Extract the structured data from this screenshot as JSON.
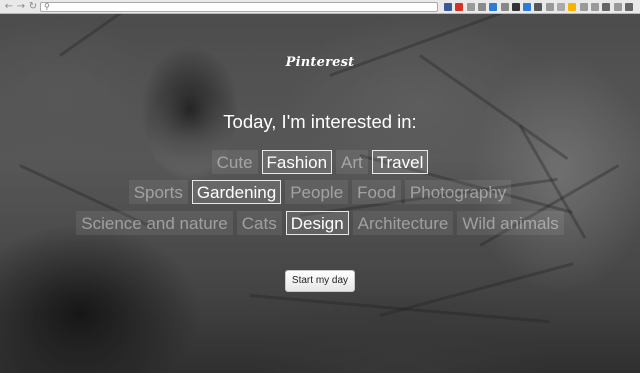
{
  "browser": {
    "back_glyph": "←",
    "forward_glyph": "→",
    "reload_glyph": "↻",
    "search_glyph": "⚲",
    "extension_icons": [
      {
        "name": "bookmark-icon",
        "color": "#3b5998"
      },
      {
        "name": "gmail-icon",
        "color": "#d93025"
      },
      {
        "name": "calendar-icon",
        "color": "#9a9a9a"
      },
      {
        "name": "thumb-icon",
        "color": "#8a8a8a"
      },
      {
        "name": "clock-icon",
        "color": "#2e7bd6"
      },
      {
        "name": "grid-icon",
        "color": "#888888"
      },
      {
        "name": "flash-icon",
        "color": "#333333"
      },
      {
        "name": "help-icon",
        "color": "#2e7bd6"
      },
      {
        "name": "circle-icon",
        "color": "#555555"
      },
      {
        "name": "photo-icon",
        "color": "#999999"
      },
      {
        "name": "box-icon",
        "color": "#aaaaaa"
      },
      {
        "name": "star-icon",
        "color": "#f4b400"
      },
      {
        "name": "window-icon",
        "color": "#9a9a9a"
      },
      {
        "name": "tab-icon",
        "color": "#9a9a9a"
      },
      {
        "name": "power-icon",
        "color": "#666666"
      },
      {
        "name": "card-icon",
        "color": "#999999"
      },
      {
        "name": "menu-icon",
        "color": "#666666"
      }
    ]
  },
  "page": {
    "logo": "Pinterest",
    "heading": "Today, I'm interested in:",
    "rows": [
      [
        {
          "label": "Cute",
          "selected": false
        },
        {
          "label": "Fashion",
          "selected": true
        },
        {
          "label": "Art",
          "selected": false
        },
        {
          "label": "Travel",
          "selected": true
        }
      ],
      [
        {
          "label": "Sports",
          "selected": false
        },
        {
          "label": "Gardening",
          "selected": true
        },
        {
          "label": "People",
          "selected": false
        },
        {
          "label": "Food",
          "selected": false
        },
        {
          "label": "Photography",
          "selected": false
        }
      ],
      [
        {
          "label": "Science and nature",
          "selected": false
        },
        {
          "label": "Cats",
          "selected": false
        },
        {
          "label": "Design",
          "selected": true
        },
        {
          "label": "Architecture",
          "selected": false
        },
        {
          "label": "Wild animals",
          "selected": false
        }
      ]
    ],
    "start_button": "Start my day"
  }
}
